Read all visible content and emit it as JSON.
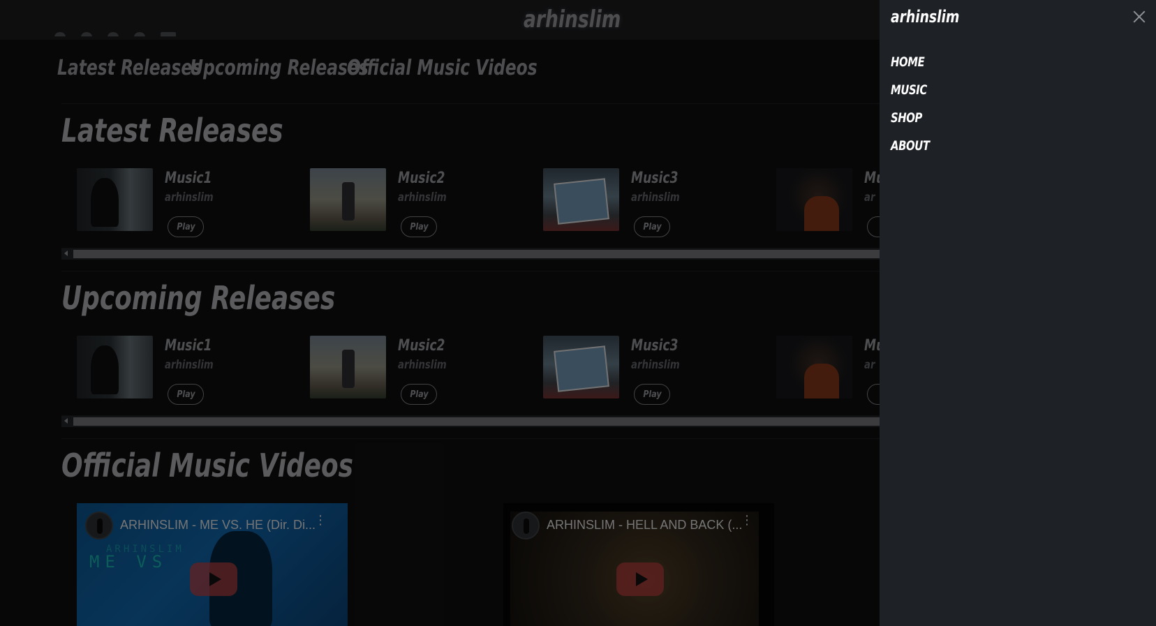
{
  "header": {
    "brand": "arhinslim"
  },
  "social_icons": [
    "instagram-icon",
    "twitter-icon",
    "soundcloud-icon",
    "spotify-icon",
    "mail-icon"
  ],
  "jump_nav": [
    "Latest Releases",
    "Upcoming Releases",
    "Official Music Videos"
  ],
  "sections": {
    "latest": {
      "title": "Latest Releases",
      "items": [
        {
          "title": "Music1",
          "artist": "arhinslim",
          "play": "Play"
        },
        {
          "title": "Music2",
          "artist": "arhinslim",
          "play": "Play"
        },
        {
          "title": "Music3",
          "artist": "arhinslim",
          "play": "Play"
        },
        {
          "title": "Mu",
          "artist": "ar",
          "play": ""
        }
      ]
    },
    "upcoming": {
      "title": "Upcoming Releases",
      "items": [
        {
          "title": "Music1",
          "artist": "arhinslim",
          "play": "Play"
        },
        {
          "title": "Music2",
          "artist": "arhinslim",
          "play": "Play"
        },
        {
          "title": "Music3",
          "artist": "arhinslim",
          "play": "Play"
        },
        {
          "title": "Mu",
          "artist": "ar",
          "play": ""
        }
      ]
    },
    "videos": {
      "title": "Official Music Videos",
      "items": [
        {
          "title": "ARHINSLIM - ME VS. HE (Dir. Di...",
          "art_text": "ME VS",
          "art_sub": "ARHINSLIM"
        },
        {
          "title": "ARHINSLIM - HELL AND BACK (..."
        }
      ]
    }
  },
  "drawer": {
    "brand": "arhinslim",
    "nav": [
      "HOME",
      "MUSIC",
      "SHOP",
      "ABOUT"
    ]
  },
  "colors": {
    "drawer_bg": "#1e2125",
    "page_bg": "#0e0e0f",
    "play_button": "#b43c3c"
  }
}
